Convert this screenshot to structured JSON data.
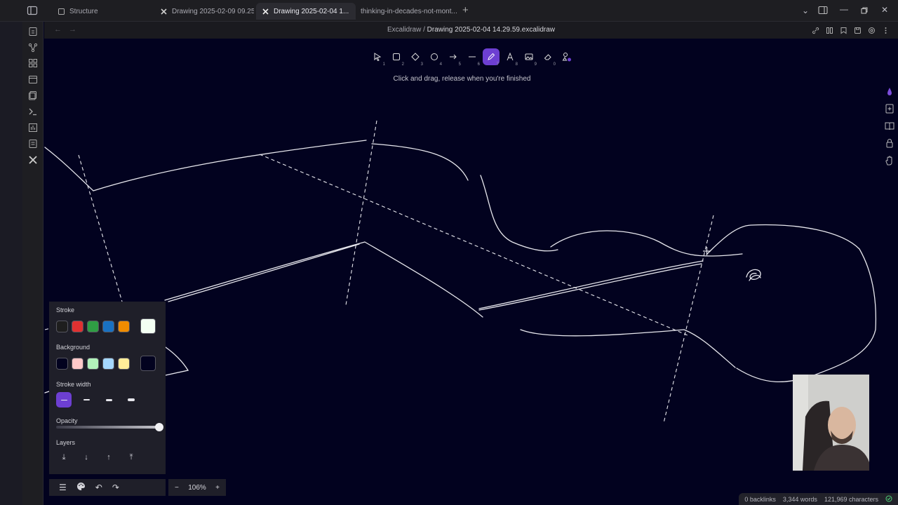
{
  "tabs": [
    {
      "label": "Structure",
      "icon": "file-icon",
      "active": false
    },
    {
      "label": "Drawing 2025-02-09 09.25....",
      "icon": "excalidraw-icon",
      "active": false
    },
    {
      "label": "Drawing 2025-02-04 1...",
      "icon": "excalidraw-icon",
      "active": true
    },
    {
      "label": "thinking-in-decades-not-mont...",
      "icon": "",
      "active": false
    }
  ],
  "header": {
    "breadcrumb_parent": "Excalidraw",
    "breadcrumb_sep": "/",
    "breadcrumb_file": "Drawing 2025-02-04 14.29.59.excalidraw"
  },
  "toolbar": {
    "tools": [
      {
        "name": "selection-tool",
        "icon": "pointer-icon",
        "key": "1"
      },
      {
        "name": "rectangle-tool",
        "icon": "rectangle-icon",
        "key": "2"
      },
      {
        "name": "diamond-tool",
        "icon": "diamond-icon",
        "key": "3"
      },
      {
        "name": "ellipse-tool",
        "icon": "ellipse-icon",
        "key": "4"
      },
      {
        "name": "arrow-tool",
        "icon": "arrow-icon",
        "key": "5"
      },
      {
        "name": "line-tool",
        "icon": "line-icon",
        "key": "6"
      },
      {
        "name": "draw-tool",
        "icon": "pencil-icon",
        "key": "7",
        "active": true
      },
      {
        "name": "text-tool",
        "icon": "text-icon",
        "key": "8"
      },
      {
        "name": "image-tool",
        "icon": "image-icon",
        "key": "9"
      },
      {
        "name": "eraser-tool",
        "icon": "eraser-icon",
        "key": "0"
      },
      {
        "name": "shapes-tool",
        "icon": "shapes-icon",
        "key": ""
      }
    ],
    "hint": "Click and drag, release when you're finished"
  },
  "properties": {
    "stroke_label": "Stroke",
    "stroke_colors": [
      "#1e1e1e",
      "#e03131",
      "#2f9e44",
      "#1971c2",
      "#f08c00"
    ],
    "stroke_selected": "#f3fff3",
    "background_label": "Background",
    "background_colors": [
      "#02021f",
      "#ffc9c9",
      "#b2f2bb",
      "#a5d8ff",
      "#ffec99"
    ],
    "background_selected": "#02021f",
    "stroke_width_label": "Stroke width",
    "opacity_label": "Opacity",
    "opacity_value": 1.0,
    "layers_label": "Layers"
  },
  "zoom": {
    "minus": "−",
    "value": "106%",
    "plus": "+"
  },
  "footer": {
    "menu": "☰",
    "undo": "↶",
    "redo": "↷"
  },
  "status": {
    "backlinks": "0 backlinks",
    "words": "3,344 words",
    "characters": "121,969 characters"
  },
  "colors": {
    "accent": "#6d3fd2",
    "canvas": "#02021f"
  }
}
